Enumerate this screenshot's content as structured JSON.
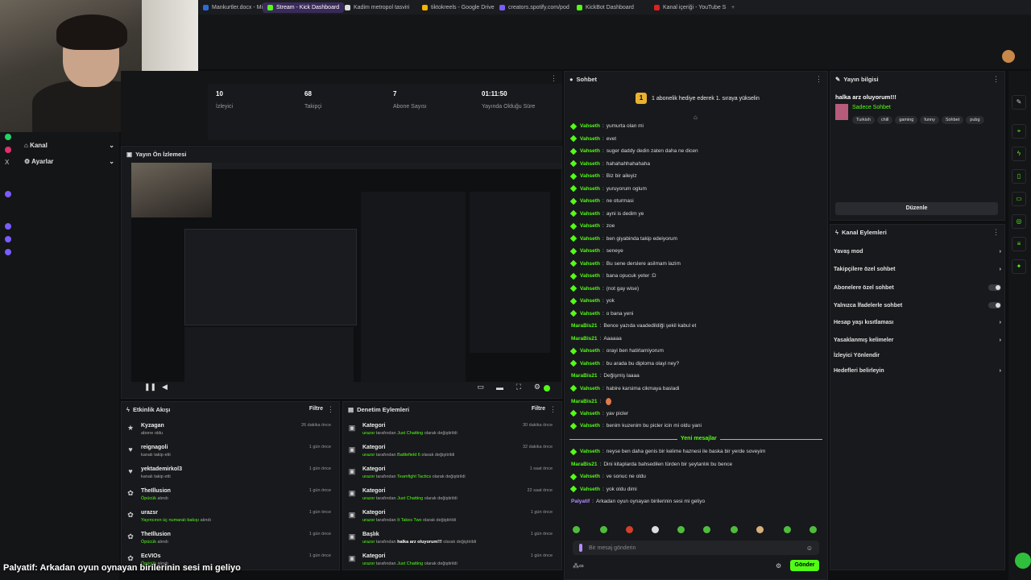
{
  "browser": {
    "tabs": [
      {
        "label": "Mankurtler.docx - Micros",
        "active": false,
        "color": "#2b6cd8"
      },
      {
        "label": "Stream - Kick Dashboard",
        "active": true,
        "color": "#53fc18"
      },
      {
        "label": "Kadim metropol tasviri",
        "active": false,
        "color": "#ddd"
      },
      {
        "label": "tiktokreels - Google Drive",
        "active": false,
        "color": "#f4b400"
      },
      {
        "label": "creators.spotify.com/pod",
        "active": false,
        "color": "#7a5cff"
      },
      {
        "label": "KickBot Dashboard",
        "active": false,
        "color": "#53fc18"
      },
      {
        "label": "Kanal içeriği - YouTube S",
        "active": false,
        "color": "#e02020"
      }
    ]
  },
  "leftnav": {
    "items": [
      {
        "label": "Kanal",
        "icon": "home-icon"
      },
      {
        "label": "Ayarlar",
        "icon": "gear-icon"
      }
    ]
  },
  "stats": [
    {
      "value": "10",
      "label": "İzleyici"
    },
    {
      "value": "68",
      "label": "Takipçi"
    },
    {
      "value": "7",
      "label": "Abone Sayısı"
    },
    {
      "value": "01:11:50",
      "label": "Yayında Olduğu Süre"
    }
  ],
  "preview": {
    "title": "Yayın Ön İzlemesi"
  },
  "activity": {
    "title": "Etkinlik Akışı",
    "filter": "Filtre",
    "rows": [
      {
        "name": "Kyzagan",
        "sub": "abone oldu",
        "time": "26 dakika önce",
        "icon": "star-icon"
      },
      {
        "name": "reignagoli",
        "sub": "kanalı takip etti",
        "time": "1 gün önce",
        "icon": "heart-icon"
      },
      {
        "name": "yektademirkol3",
        "sub": "kanalı takip etti",
        "time": "1 gün önce",
        "icon": "heart-icon"
      },
      {
        "name": "TheIllusion",
        "sub_hl": "Öpücük",
        "sub": " alındı",
        "time": "1 gün önce",
        "icon": "gift-icon"
      },
      {
        "name": "urazsr",
        "sub_hl": "Yayıncının üç numaralı bakışı",
        "sub": " alındı",
        "time": "1 gün önce",
        "icon": "gift-icon"
      },
      {
        "name": "TheIllusion",
        "sub_hl": "Öpücük",
        "sub": " alındı",
        "time": "1 gün önce",
        "icon": "gift-icon"
      },
      {
        "name": "EcVIOs",
        "sub_hl": "Öpücük",
        "sub": " alındı",
        "time": "1 gün önce",
        "icon": "gift-icon"
      }
    ]
  },
  "moderation": {
    "title": "Denetim Eylemleri",
    "filter": "Filtre",
    "rows": [
      {
        "name": "Kategori",
        "user": "urazsr",
        "mid": " tarafından ",
        "hl": "Just Chatting",
        "end": " olarak değiştirildi",
        "time": "30 dakika önce"
      },
      {
        "name": "Kategori",
        "user": "urazsr",
        "mid": " tarafından ",
        "hl": "Battlefield 6",
        "end": " olarak değiştirildi",
        "time": "32 dakika önce"
      },
      {
        "name": "Kategori",
        "user": "urazsr",
        "mid": " tarafından ",
        "hl": "Teamfight Tactics",
        "end": " olarak değiştirildi",
        "time": "1 saat önce"
      },
      {
        "name": "Kategori",
        "user": "urazsr",
        "mid": " tarafından ",
        "hl": "Just Chatting",
        "end": " olarak değiştirildi",
        "time": "22 saat önce"
      },
      {
        "name": "Kategori",
        "user": "urazsr",
        "mid": " tarafından ",
        "hl": "It Takes Two",
        "end": " olarak değiştirildi",
        "time": "1 gün önce"
      },
      {
        "name": "Başlık",
        "user": "urazsr",
        "mid": " tarafından ",
        "hl": "halka arz oluyorum!!!",
        "end": " olarak değiştirildi",
        "time": "1 gün önce"
      },
      {
        "name": "Kategori",
        "user": "urazsr",
        "mid": " tarafından ",
        "hl": "Just Chatting",
        "end": " olarak değiştirildi",
        "time": "1 gün önce"
      }
    ]
  },
  "chat": {
    "title": "Sohbet",
    "banner": "1 abonelik hediye ederek 1. sıraya yükselin",
    "new_messages": "Yeni mesajlar",
    "messages": [
      {
        "user": "Vahseth",
        "text": "yumurta olan mi",
        "badge": true,
        "c": "v"
      },
      {
        "user": "Vahseth",
        "text": "evet",
        "badge": true,
        "c": "v"
      },
      {
        "user": "Vahseth",
        "text": "suger daddy dedin zaten daha ne dicen",
        "badge": true,
        "c": "v"
      },
      {
        "user": "Vahseth",
        "text": "hahahahhahahaha",
        "badge": true,
        "c": "v"
      },
      {
        "user": "Vahseth",
        "text": "Biz bir aileyiz",
        "badge": true,
        "c": "v"
      },
      {
        "user": "Vahseth",
        "text": "yuruyorum oglum",
        "badge": true,
        "c": "v"
      },
      {
        "user": "Vahseth",
        "text": "ne oturmasi",
        "badge": true,
        "c": "v"
      },
      {
        "user": "Vahseth",
        "text": "ayni is dedim ye",
        "badge": true,
        "c": "v"
      },
      {
        "user": "Vahseth",
        "text": "zoe",
        "badge": true,
        "c": "v"
      },
      {
        "user": "Vahseth",
        "text": "ben giyabinda takip edeiyorum",
        "badge": true,
        "c": "v"
      },
      {
        "user": "Vahseth",
        "text": "seneye",
        "badge": true,
        "c": "v"
      },
      {
        "user": "Vahseth",
        "text": "Bu sene derslere asilmam lazim",
        "badge": true,
        "c": "v"
      },
      {
        "user": "Vahseth",
        "text": "bana opucuk yeter :D",
        "badge": true,
        "c": "v"
      },
      {
        "user": "Vahseth",
        "text": "(not gay wise)",
        "badge": true,
        "c": "v"
      },
      {
        "user": "Vahseth",
        "text": "yok",
        "badge": true,
        "c": "v"
      },
      {
        "user": "Vahseth",
        "text": "o bana yeni",
        "badge": true,
        "c": "v"
      },
      {
        "user": "MaraBis21",
        "text": "Bence yazıda vaadedildiği şekil kabul et",
        "badge": false,
        "c": "m"
      },
      {
        "user": "MaraBis21",
        "text": "Aaaaaa",
        "badge": false,
        "c": "m"
      },
      {
        "user": "Vahseth",
        "text": "orayi ben hatirlamiyorum",
        "badge": true,
        "c": "v"
      },
      {
        "user": "Vahseth",
        "text": "bu arada bu diploma olayi ney?",
        "badge": true,
        "c": "v"
      },
      {
        "user": "MaraBis21",
        "text": "Değişmiş laaaa",
        "badge": false,
        "c": "m"
      },
      {
        "user": "Vahseth",
        "text": "habire karsima cikmaya basladi",
        "badge": true,
        "c": "v"
      },
      {
        "user": "MaraBis21",
        "text": "",
        "badge": false,
        "c": "m"
      },
      {
        "user": "Vahseth",
        "text": "yav picler",
        "badge": true,
        "c": "v"
      },
      {
        "user": "Vahseth",
        "text": "benim kuzenim bu picler icin mi oldu yani",
        "badge": true,
        "c": "v"
      }
    ],
    "after": [
      {
        "user": "Vahseth",
        "text": "neyse ben daha genis bir kelime haznesi ile baska bir yerde soveyim",
        "badge": true,
        "c": "v"
      },
      {
        "user": "MaraBis21",
        "text": "Dini kitaplarda bahsedilen türden bir şeytanlık bu bence",
        "badge": false,
        "c": "m"
      },
      {
        "user": "Vahseth",
        "text": "ve sonuc ne oldu",
        "badge": true,
        "c": "v"
      },
      {
        "user": "Vahseth",
        "text": "yok oldu dimi",
        "badge": true,
        "c": "v"
      },
      {
        "user": "Palyatif",
        "text": "Arkadan oyun oynayan birilerinin sesi mi geliyo",
        "badge": false,
        "c": "p"
      }
    ],
    "input_placeholder": "Bir mesaj gönderin",
    "send": "Gönder"
  },
  "streaminfo": {
    "title": "Yayın bilgisi",
    "stream_title": "halka arz oluyorum!!!",
    "category": "Sadece Sohbet",
    "tags": [
      "Turkish",
      "chill",
      "gaming",
      "funny",
      "Sohbet",
      "pubg"
    ],
    "edit": "Düzenle"
  },
  "actions": {
    "title": "Kanal Eylemleri",
    "items": [
      {
        "label": "Yavaş mod",
        "type": "arrow"
      },
      {
        "label": "Takipçilere özel sohbet",
        "type": "arrow"
      },
      {
        "label": "Abonelere özel sohbet",
        "type": "toggle"
      },
      {
        "label": "Yalnızca İfadelerle sohbet",
        "type": "toggle"
      },
      {
        "label": "Hesap yaşı kısıtlaması",
        "type": "arrow"
      },
      {
        "label": "Yasaklanmış kelimeler",
        "type": "arrow"
      },
      {
        "label": "İzleyici Yönlendir",
        "type": "none"
      },
      {
        "label": "Hedefleri belirleyin",
        "type": "arrow"
      }
    ]
  },
  "caption": "Palyatif: Arkadan oyun oynayan birilerinin sesi mi geliyo",
  "accent": "#53fc18"
}
